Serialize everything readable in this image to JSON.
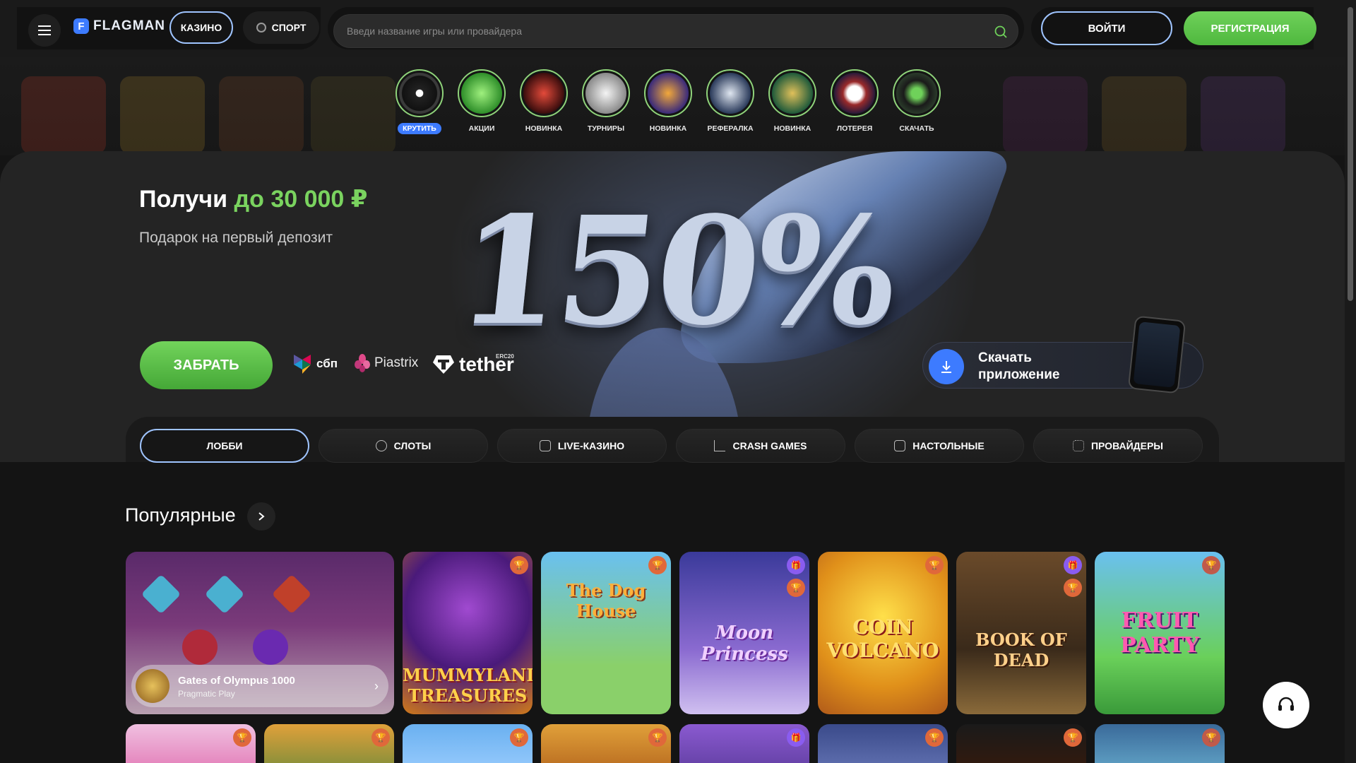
{
  "header": {
    "logo_letter": "F",
    "logo_text": "FLAGMAN",
    "nav_casino": "КАЗИНО",
    "nav_sport": "СПОРТ",
    "search_placeholder": "Введи название игры или провайдера",
    "login": "ВОЙТИ",
    "register": "РЕГИСТРАЦИЯ"
  },
  "stories": [
    {
      "label": "КРУТИТЬ",
      "active": true
    },
    {
      "label": "АКЦИИ"
    },
    {
      "label": "НОВИНКА"
    },
    {
      "label": "ТУРНИРЫ"
    },
    {
      "label": "НОВИНКА"
    },
    {
      "label": "РЕФЕРАЛКА"
    },
    {
      "label": "НОВИНКА"
    },
    {
      "label": "ЛОТЕРЕЯ"
    },
    {
      "label": "СКАЧАТЬ"
    }
  ],
  "banner": {
    "title_prefix": "Получи",
    "title_amount": "до 30 000 ₽",
    "subtitle": "Подарок на первый депозит",
    "big_number": "150%",
    "cta": "ЗАБРАТЬ",
    "payments": {
      "sbp": "сбп",
      "piastrix": "Piastrix",
      "tether": "tether",
      "tether_badge": "ERC20"
    },
    "app_download": "Скачать приложение"
  },
  "tabs": [
    "ЛОББИ",
    "СЛОТЫ",
    "LIVE-КАЗИНО",
    "CRASH GAMES",
    "НАСТОЛЬНЫЕ",
    "ПРОВАЙДЕРЫ"
  ],
  "popular": {
    "title": "Популярные",
    "featured": {
      "name": "Gates of Olympus 1000",
      "provider": "Pragmatic Play"
    },
    "row1_titles": [
      "MUMMYLAND TREASURES",
      "The Dog House",
      "Moon Princess",
      "COIN VOLCANO",
      "BOOK OF DEAD",
      "FRUIT PARTY"
    ]
  },
  "colors": {
    "accent_green": "#6fd15a",
    "accent_blue": "#3d7bff",
    "outline_blue": "#9fc4ff",
    "bg": "#141414"
  }
}
